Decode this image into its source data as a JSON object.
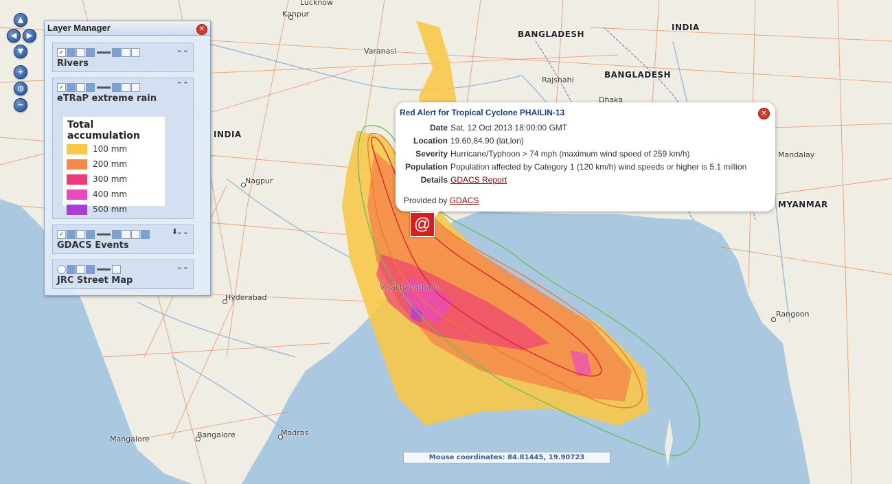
{
  "map": {
    "colors": {
      "sea": "#aac8e0",
      "land": "#f0eee4",
      "roads": "#e8825a",
      "rivers": "#8fb3d8",
      "borders": "#a083b8"
    },
    "cities": [
      "Lucknow",
      "Kanpur",
      "Varanasi",
      "Rajshahi",
      "Dhaka",
      "Nagpur",
      "Hyderabad",
      "Visakhapatnam",
      "Mandalay",
      "Rangoon",
      "Mangalore",
      "Bangalore",
      "Madras"
    ],
    "countries": [
      "BANGLADESH",
      "BANGLADESH",
      "INDIA",
      "INDIA",
      "MYANMAR"
    ],
    "icons": [
      "pan-up-icon",
      "pan-left-icon",
      "pan-right-icon",
      "pan-down-icon",
      "zoom-in-icon",
      "zoom-world-icon",
      "zoom-out-icon",
      "close-icon",
      "cyclone-icon"
    ]
  },
  "layer_manager": {
    "title": "Layer Manager",
    "layers": [
      {
        "name": "Rivers",
        "checked": true
      },
      {
        "name": "eTRaP extreme rain",
        "checked": true
      },
      {
        "name": "GDACS Events",
        "checked": true
      },
      {
        "name": "JRC Street Map",
        "checked": true
      }
    ],
    "legend": {
      "title": "Total accumulation",
      "items": [
        {
          "label": "100 mm",
          "color": "#f7c84a"
        },
        {
          "label": "200 mm",
          "color": "#f4894a"
        },
        {
          "label": "300 mm",
          "color": "#ec3b78"
        },
        {
          "label": "400 mm",
          "color": "#e84bc0"
        },
        {
          "label": "500 mm",
          "color": "#a93dd6"
        }
      ]
    }
  },
  "popup": {
    "title": "Red Alert for Tropical Cyclone PHAILIN-13",
    "rows": [
      {
        "key": "Date",
        "value": "Sat, 12 Oct 2013 18:00:00 GMT"
      },
      {
        "key": "Location",
        "value": "19.60,84.90 (lat,lon)"
      },
      {
        "key": "Severity",
        "value": "Hurricane/Typhoon > 74 mph (maximum wind speed of 259 km/h)"
      },
      {
        "key": "Population",
        "value": "Population affected by Category 1 (120 km/h) wind speeds or higher is 5.1 million"
      },
      {
        "key": "Details",
        "value": "GDACS Report"
      }
    ],
    "provided_by": "Provided by",
    "provided_link": "GDACS"
  },
  "status": {
    "mouse_coordinates": "Mouse coordinates: 84.81445, 19.90723"
  }
}
